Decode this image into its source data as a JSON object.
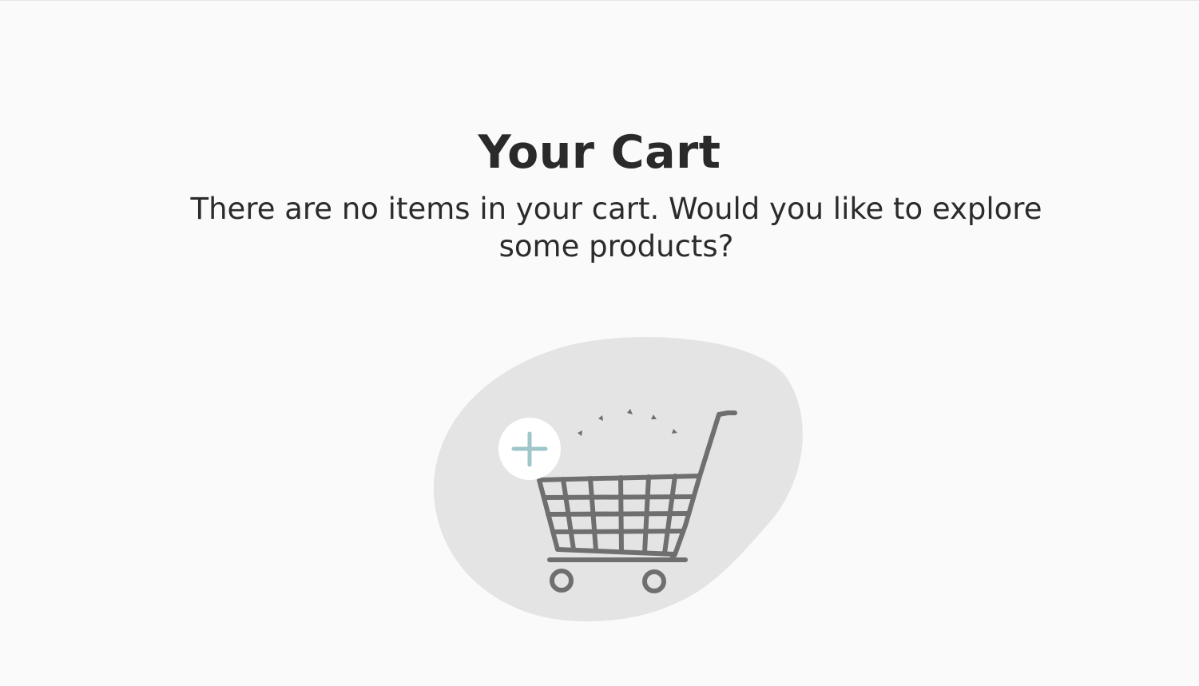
{
  "cart": {
    "title": "Your Cart",
    "empty_message": "There are no items in your cart. Would you like to explore some products?"
  },
  "illustration": {
    "blob_color": "#e4e4e4",
    "cart_color": "#6f6f6f",
    "plus_badge_color": "#ffffff",
    "plus_color": "#9fc6c8"
  }
}
